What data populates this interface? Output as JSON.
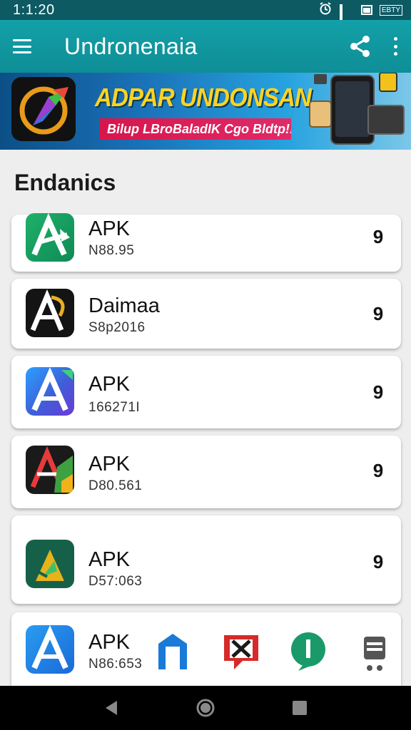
{
  "status_bar": {
    "time": "1:1:20",
    "wifi_label": "EBTY"
  },
  "app_bar": {
    "title": "Undronenaia"
  },
  "banner": {
    "headline": "ADPAR UNDONSAN",
    "subline": "Bilup LBroBaladIK Cgo Bldtp!!"
  },
  "section": {
    "title": "Endanics"
  },
  "apps": [
    {
      "name": "APK",
      "sub": "N88.95",
      "action": "9"
    },
    {
      "name": "Daimaa",
      "sub": "S8p2016",
      "action": "9"
    },
    {
      "name": "APK",
      "sub": "166271I",
      "action": "9"
    },
    {
      "name": "APK",
      "sub": "D80.561",
      "action": "9"
    },
    {
      "name": "APK",
      "sub": "D57:063",
      "action": "9"
    },
    {
      "name": "APK",
      "sub": "N86:653"
    }
  ],
  "colors": {
    "app_bar": "#13a0a8",
    "status_bar": "#0d5a63",
    "banner_accent": "#ffd321"
  }
}
